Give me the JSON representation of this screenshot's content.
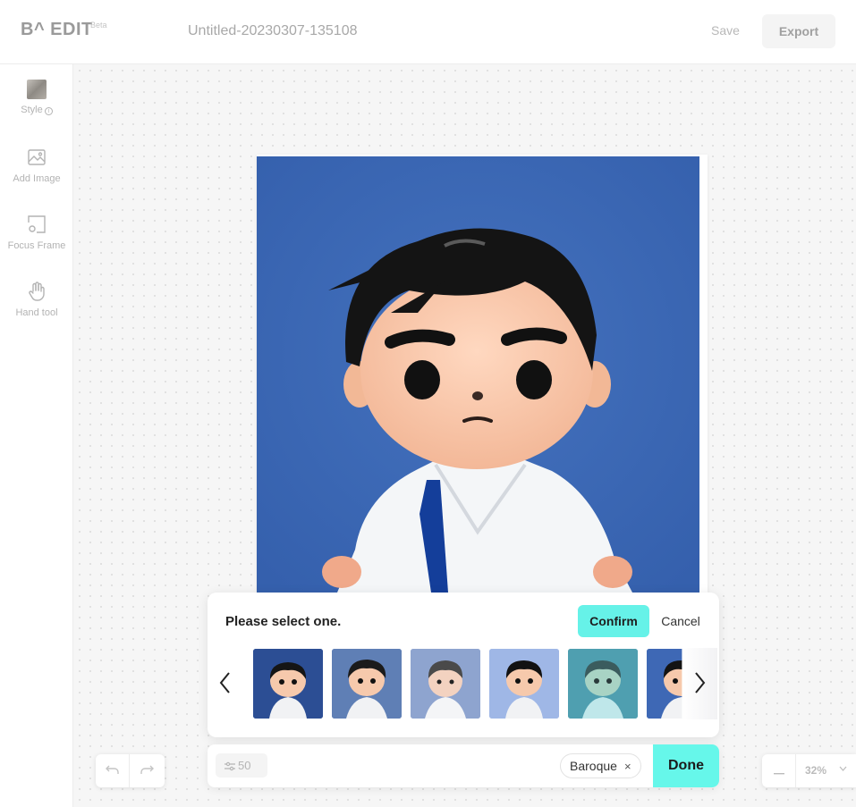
{
  "header": {
    "logo_text": "B^ EDIT",
    "beta_label": "Beta",
    "document_title": "Untitled-20230307-135108",
    "save_label": "Save",
    "export_label": "Export"
  },
  "sidebar": {
    "items": [
      {
        "label": "Style",
        "icon": "style-thumbnail"
      },
      {
        "label": "Add Image",
        "icon": "image-icon"
      },
      {
        "label": "Focus Frame",
        "icon": "focus-frame-icon"
      },
      {
        "label": "Hand tool",
        "icon": "hand-icon"
      }
    ]
  },
  "selection_panel": {
    "title": "Please select one.",
    "confirm_label": "Confirm",
    "cancel_label": "Cancel",
    "thumbnail_count_visible": 6
  },
  "bottom_bar": {
    "strength_value": "50",
    "style_chip": "Baroque",
    "chip_remove": "×",
    "done_label": "Done"
  },
  "zoom": {
    "value": "32%"
  },
  "colors": {
    "accent": "#66f2e8",
    "artboard_background": "#3a67b5",
    "muted_text": "#b3b3b3"
  }
}
